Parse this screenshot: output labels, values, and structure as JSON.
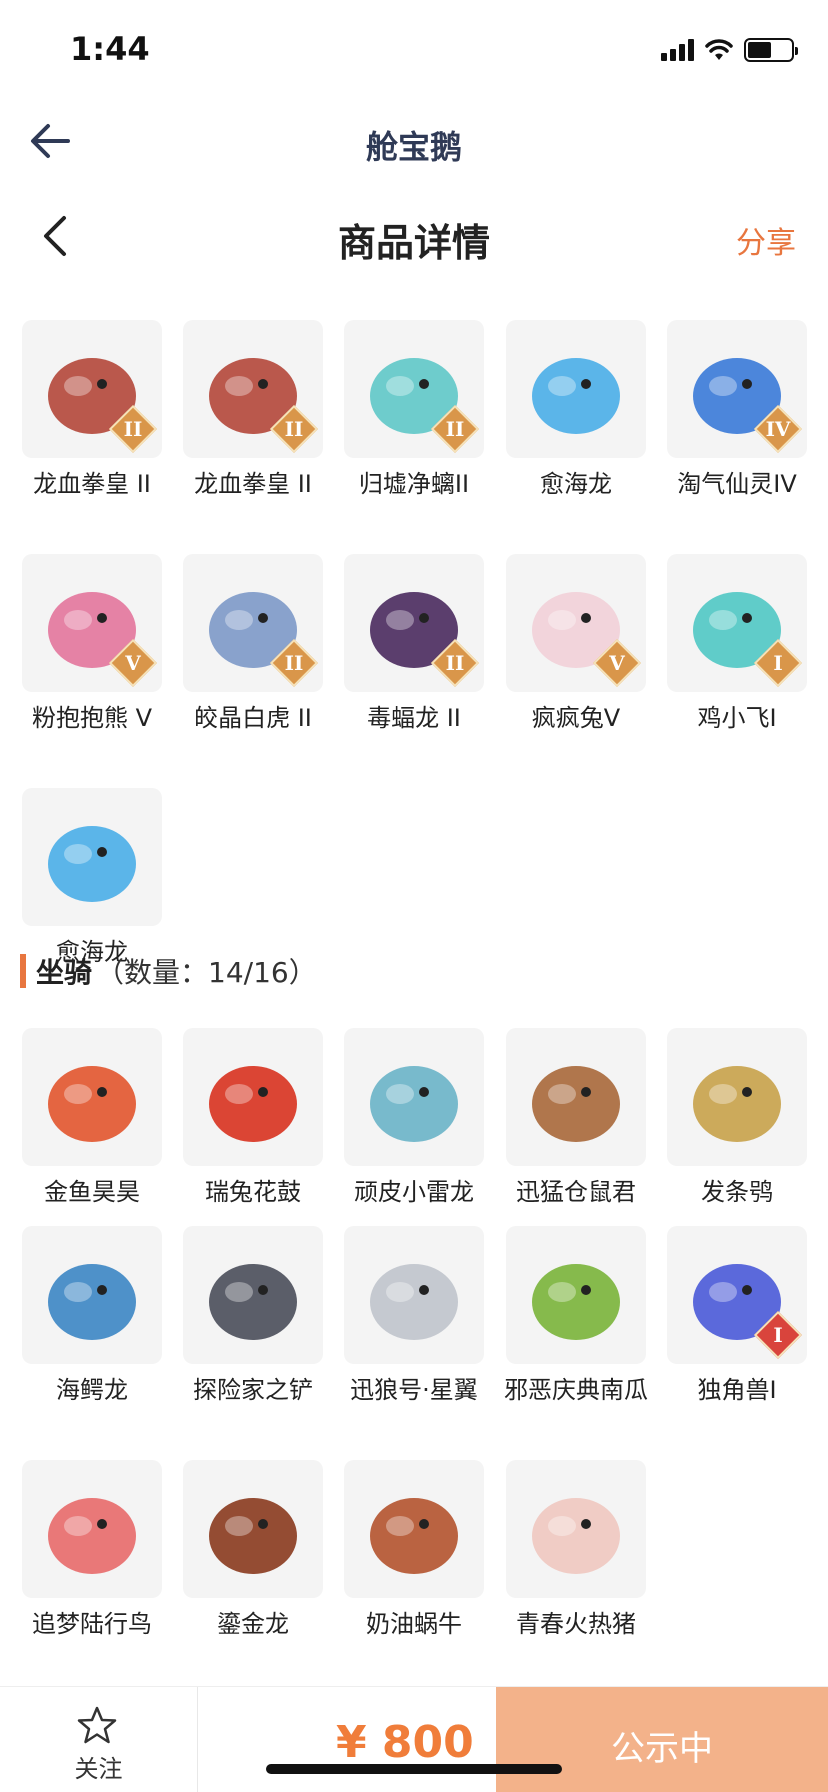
{
  "status_bar": {
    "time": "1:44"
  },
  "app_nav": {
    "title": "舱宝鹅"
  },
  "page_header": {
    "title": "商品详情",
    "share": "分享"
  },
  "pets": [
    {
      "name": "龙血拳皇 II",
      "badge": "II",
      "color": "#b4473a"
    },
    {
      "name": "龙血拳皇 II",
      "badge": "II",
      "color": "#b4473a"
    },
    {
      "name": "归墟净螭II",
      "badge": "II",
      "color": "#5fc8c8"
    },
    {
      "name": "愈海龙",
      "badge": "",
      "color": "#4aaee8"
    },
    {
      "name": "淘气仙灵IV",
      "badge": "IV",
      "color": "#3a7ad8"
    },
    {
      "name": "粉抱抱熊 V",
      "badge": "V",
      "color": "#e3769c"
    },
    {
      "name": "皎晶白虎 II",
      "badge": "II",
      "color": "#7d99c8"
    },
    {
      "name": "毒蝠龙 II",
      "badge": "II",
      "color": "#4a2a5e"
    },
    {
      "name": "疯疯兔V",
      "badge": "V",
      "color": "#f2d0d8"
    },
    {
      "name": "鸡小飞I",
      "badge": "I",
      "color": "#50c8c4"
    },
    {
      "name": "愈海龙",
      "badge": "",
      "color": "#4aaee8"
    }
  ],
  "mounts_section": {
    "name": "坐骑",
    "count": "（数量：14/16）"
  },
  "mounts": [
    {
      "name": "金鱼昊昊",
      "badge": "",
      "color": "#e2552e"
    },
    {
      "name": "瑞兔花鼓",
      "badge": "",
      "color": "#d8321f"
    },
    {
      "name": "顽皮小雷龙",
      "badge": "",
      "color": "#6ab4c8"
    },
    {
      "name": "迅猛仓鼠君",
      "badge": "",
      "color": "#a8683a"
    },
    {
      "name": "发条鸮",
      "badge": "",
      "color": "#c8a24a"
    },
    {
      "name": "海鳄龙",
      "badge": "",
      "color": "#3c86c4"
    },
    {
      "name": "探险家之铲",
      "badge": "",
      "color": "#4a4e5a"
    },
    {
      "name": "迅狼号·星翼",
      "badge": "",
      "color": "#c0c4cc"
    },
    {
      "name": "邪恶庆典南瓜",
      "badge": "",
      "color": "#7ab43a"
    },
    {
      "name": "独角兽I",
      "badge": "I",
      "color": "#4a5ad8"
    },
    {
      "name": "追梦陆行鸟",
      "badge": "",
      "color": "#e86a6a"
    },
    {
      "name": "鎏金龙",
      "badge": "",
      "color": "#8a3a1e"
    },
    {
      "name": "奶油蜗牛",
      "badge": "",
      "color": "#b4532e"
    },
    {
      "name": "青春火热猪",
      "badge": "",
      "color": "#f0c8c0"
    }
  ],
  "bottom_bar": {
    "follow_label": "关注",
    "price": "¥ 800",
    "status_label": "公示中"
  },
  "colors": {
    "accent": "#e8763f",
    "price": "#f07d3a",
    "status_button": "#f3b28a"
  },
  "icons": {
    "back": "arrow-left-icon",
    "page_back": "chevron-left-icon",
    "follow": "star-outline-icon"
  }
}
